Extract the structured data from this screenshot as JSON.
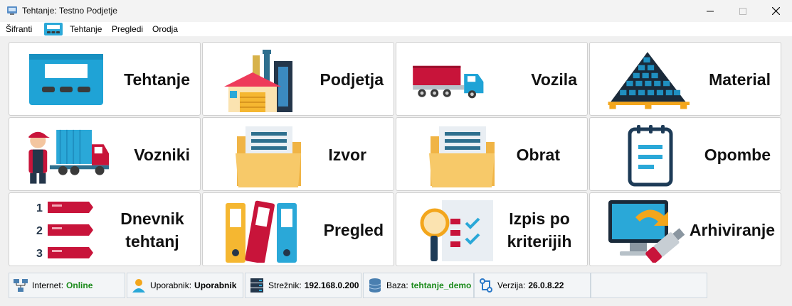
{
  "window": {
    "title": "Tehtanje: Testno Podjetje"
  },
  "menu": {
    "items": [
      "Šifranti",
      "Tehtanje",
      "Pregledi",
      "Orodja"
    ]
  },
  "tiles": [
    {
      "label": "Tehtanje",
      "icon": "scale-icon"
    },
    {
      "label": "Podjetja",
      "icon": "factory-icon"
    },
    {
      "label": "Vozila",
      "icon": "truck-icon"
    },
    {
      "label": "Material",
      "icon": "coal-pile-icon"
    },
    {
      "label": "Vozniki",
      "icon": "driver-icon"
    },
    {
      "label": "Izvor",
      "icon": "folder-icon"
    },
    {
      "label": "Obrat",
      "icon": "folder-icon"
    },
    {
      "label": "Opombe",
      "icon": "notepad-icon"
    },
    {
      "label": "Dnevnik tehtanj",
      "icon": "numbered-list-icon"
    },
    {
      "label": "Pregled",
      "icon": "binders-icon"
    },
    {
      "label": "Izpis po kriterijih",
      "icon": "checklist-search-icon"
    },
    {
      "label": "Arhiviranje",
      "icon": "usb-backup-icon"
    }
  ],
  "status": {
    "internet": {
      "label": "Internet:",
      "value": "Online",
      "color": "#1a8a1a"
    },
    "user": {
      "label": "Uporabnik:",
      "value": "Uporabnik",
      "color": "#000000"
    },
    "server": {
      "label": "Strežnik:",
      "value": "192.168.0.200",
      "color": "#000000"
    },
    "database": {
      "label": "Baza:",
      "value": "tehtanje_demo",
      "color": "#1a8a1a"
    },
    "version": {
      "label": "Verzija:",
      "value": "26.0.8.22",
      "color": "#000000"
    }
  },
  "list_numbers": [
    "1",
    "2",
    "3"
  ]
}
